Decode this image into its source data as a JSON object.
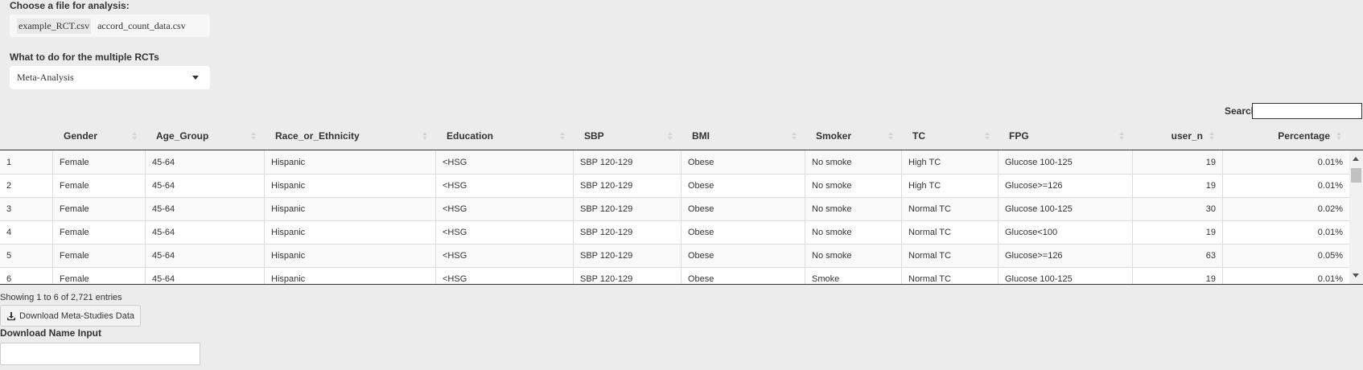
{
  "file_section": {
    "label": "Choose a file for analysis:",
    "files": [
      "example_RCT.csv",
      "accord_count_data.csv"
    ]
  },
  "rct_section": {
    "label": "What to do for the multiple RCTs",
    "selected": "Meta-Analysis"
  },
  "search": {
    "label": "Search:",
    "value": ""
  },
  "table": {
    "columns": [
      "",
      "Gender",
      "Age_Group",
      "Race_or_Ethnicity",
      "Education",
      "SBP",
      "BMI",
      "Smoker",
      "TC",
      "FPG",
      "user_n",
      "Percentage"
    ],
    "rows": [
      [
        "1",
        "Female",
        "45-64",
        "Hispanic",
        "<HSG",
        "SBP 120-129",
        "Obese",
        "No smoke",
        "High TC",
        "Glucose 100-125",
        "19",
        "0.01%"
      ],
      [
        "2",
        "Female",
        "45-64",
        "Hispanic",
        "<HSG",
        "SBP 120-129",
        "Obese",
        "No smoke",
        "High TC",
        "Glucose>=126",
        "19",
        "0.01%"
      ],
      [
        "3",
        "Female",
        "45-64",
        "Hispanic",
        "<HSG",
        "SBP 120-129",
        "Obese",
        "No smoke",
        "Normal TC",
        "Glucose 100-125",
        "30",
        "0.02%"
      ],
      [
        "4",
        "Female",
        "45-64",
        "Hispanic",
        "<HSG",
        "SBP 120-129",
        "Obese",
        "No smoke",
        "Normal TC",
        "Glucose<100",
        "19",
        "0.01%"
      ],
      [
        "5",
        "Female",
        "45-64",
        "Hispanic",
        "<HSG",
        "SBP 120-129",
        "Obese",
        "No smoke",
        "Normal TC",
        "Glucose>=126",
        "63",
        "0.05%"
      ],
      [
        "6",
        "Female",
        "45-64",
        "Hispanic",
        "<HSG",
        "SBP 120-129",
        "Obese",
        "Smoke",
        "Normal TC",
        "Glucose 100-125",
        "19",
        "0.01%"
      ]
    ],
    "info": "Showing 1 to 6 of 2,721 entries"
  },
  "download": {
    "button_label": "Download Meta-Studies Data",
    "button_icon": "download-icon",
    "name_label": "Download Name Input",
    "name_value": ""
  }
}
